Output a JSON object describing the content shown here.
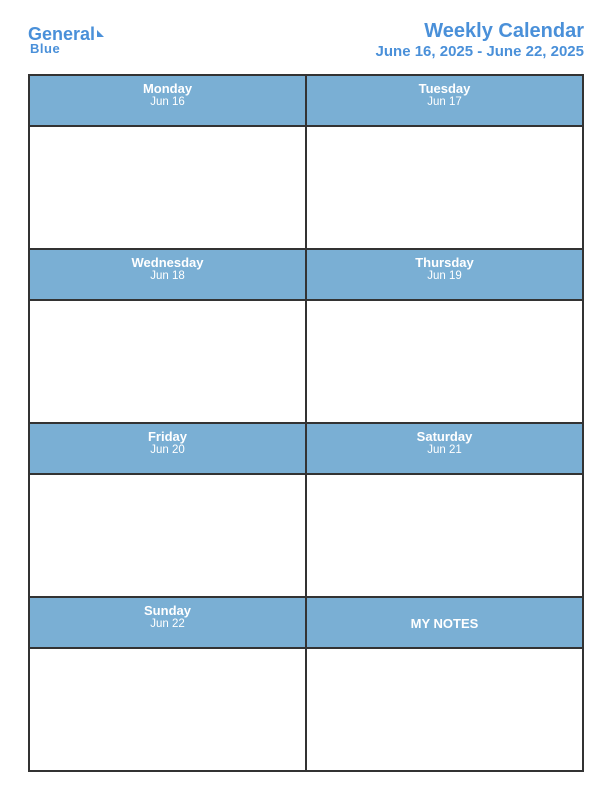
{
  "header": {
    "logo_general": "General",
    "logo_blue": "Blue",
    "title": "Weekly Calendar",
    "date_range": "June 16, 2025 - June 22, 2025"
  },
  "days": [
    {
      "name": "Monday",
      "date": "Jun 16"
    },
    {
      "name": "Tuesday",
      "date": "Jun 17"
    },
    {
      "name": "Wednesday",
      "date": "Jun 18"
    },
    {
      "name": "Thursday",
      "date": "Jun 19"
    },
    {
      "name": "Friday",
      "date": "Jun 20"
    },
    {
      "name": "Saturday",
      "date": "Jun 21"
    },
    {
      "name": "Sunday",
      "date": "Jun 22"
    }
  ],
  "notes": {
    "label": "MY NOTES"
  }
}
